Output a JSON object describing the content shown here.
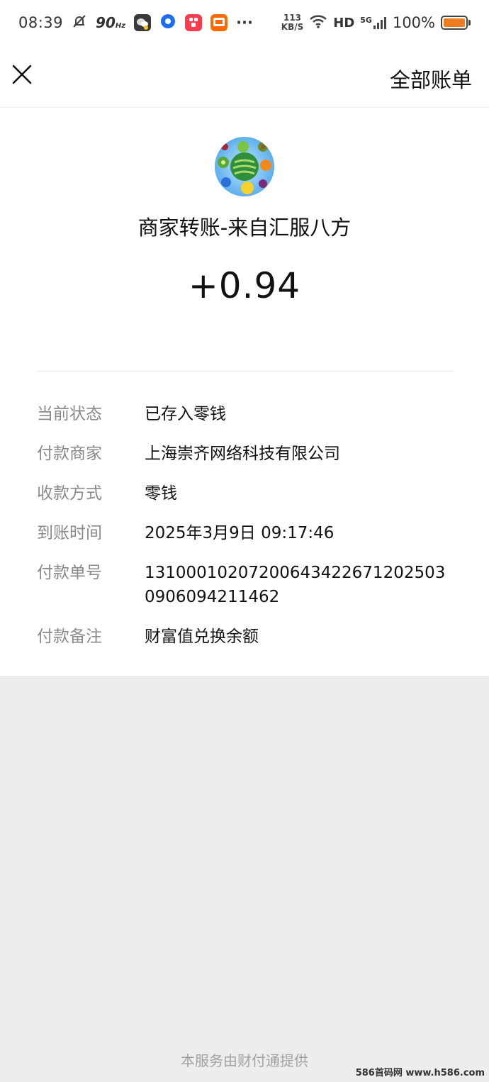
{
  "status_bar": {
    "time": "08:39",
    "refresh": "90",
    "refresh_unit": "Hz",
    "more": "···",
    "net_speed_value": "113",
    "net_speed_unit": "KB/S",
    "hd": "HD",
    "network": "5G",
    "battery": "100%"
  },
  "header": {
    "all_bills": "全部账单"
  },
  "transaction": {
    "merchant_title": "商家转账-来自汇服八方",
    "amount": "+0.94"
  },
  "details": [
    {
      "key": "当前状态",
      "value": "已存入零钱"
    },
    {
      "key": "付款商家",
      "value": "上海崇齐网络科技有限公司"
    },
    {
      "key": "收款方式",
      "value": "零钱"
    },
    {
      "key": "到账时间",
      "value": "2025年3月9日 09:17:46"
    },
    {
      "key": "付款单号",
      "value": "131000102072006434226712025030906094211462"
    },
    {
      "key": "付款备注",
      "value": "财富值兑换余额"
    }
  ],
  "footer": "本服务由财付通提供",
  "watermark": "586首码网 www.h586.com",
  "colors": {
    "background": "#ededed",
    "card": "#ffffff",
    "label": "#8a8a8a",
    "battery": "#f07a1e"
  }
}
